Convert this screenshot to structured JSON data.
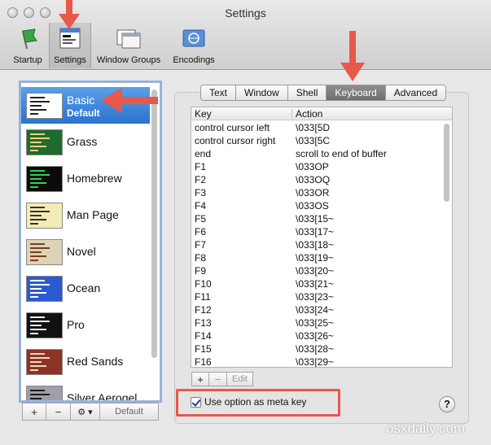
{
  "window": {
    "title": "Settings"
  },
  "toolbar": {
    "items": [
      {
        "label": "Startup",
        "icon": "green-flag-icon"
      },
      {
        "label": "Settings",
        "icon": "settings-window-icon",
        "active": true
      },
      {
        "label": "Window Groups",
        "icon": "window-groups-icon"
      },
      {
        "label": "Encodings",
        "icon": "encodings-icon"
      }
    ]
  },
  "profiles": {
    "items": [
      {
        "name": "Basic",
        "sub": "Default",
        "selected": true,
        "bg": "#ffffff",
        "fg": "#222222"
      },
      {
        "name": "Grass",
        "bg": "#1f6a2e",
        "fg": "#e6d27a"
      },
      {
        "name": "Homebrew",
        "bg": "#0b0b0b",
        "fg": "#29d64b"
      },
      {
        "name": "Man Page",
        "bg": "#f4ecb6",
        "fg": "#333333"
      },
      {
        "name": "Novel",
        "bg": "#ddd3b6",
        "fg": "#7a3d21"
      },
      {
        "name": "Ocean",
        "bg": "#2c5ad0",
        "fg": "#ffffff"
      },
      {
        "name": "Pro",
        "bg": "#111111",
        "fg": "#eeeeee"
      },
      {
        "name": "Red Sands",
        "bg": "#8c3325",
        "fg": "#eadbb8"
      },
      {
        "name": "Silver Aerogel",
        "bg": "#9f9fa9",
        "fg": "#1c1c1c"
      }
    ],
    "buttons": {
      "add": "+",
      "remove": "−",
      "gear": "⚙ ▾",
      "default": "Default"
    }
  },
  "tabs": [
    {
      "label": "Text"
    },
    {
      "label": "Window"
    },
    {
      "label": "Shell"
    },
    {
      "label": "Keyboard",
      "active": true
    },
    {
      "label": "Advanced"
    }
  ],
  "table": {
    "headers": {
      "key": "Key",
      "action": "Action"
    },
    "rows": [
      {
        "key": "control cursor left",
        "action": "\\033[5D"
      },
      {
        "key": "control cursor right",
        "action": "\\033[5C"
      },
      {
        "key": "end",
        "action": "scroll to end of buffer"
      },
      {
        "key": "F1",
        "action": "\\033OP"
      },
      {
        "key": "F2",
        "action": "\\033OQ"
      },
      {
        "key": "F3",
        "action": "\\033OR"
      },
      {
        "key": "F4",
        "action": "\\033OS"
      },
      {
        "key": "F5",
        "action": "\\033[15~"
      },
      {
        "key": "F6",
        "action": "\\033[17~"
      },
      {
        "key": "F7",
        "action": "\\033[18~"
      },
      {
        "key": "F8",
        "action": "\\033[19~"
      },
      {
        "key": "F9",
        "action": "\\033[20~"
      },
      {
        "key": "F10",
        "action": "\\033[21~"
      },
      {
        "key": "F11",
        "action": "\\033[23~"
      },
      {
        "key": "F12",
        "action": "\\033[24~"
      },
      {
        "key": "F13",
        "action": "\\033[25~"
      },
      {
        "key": "F14",
        "action": "\\033[26~"
      },
      {
        "key": "F15",
        "action": "\\033[28~"
      },
      {
        "key": "F16",
        "action": "\\033[29~"
      }
    ],
    "buttons": {
      "add": "+",
      "remove": "−",
      "edit": "Edit"
    }
  },
  "option_meta": {
    "label": "Use option as meta key",
    "checked": true
  },
  "help": {
    "label": "?"
  },
  "watermark": {
    "text": "osxdaily.com"
  },
  "colors": {
    "annotation": "#e8584b",
    "selection": "#2a73cd"
  }
}
